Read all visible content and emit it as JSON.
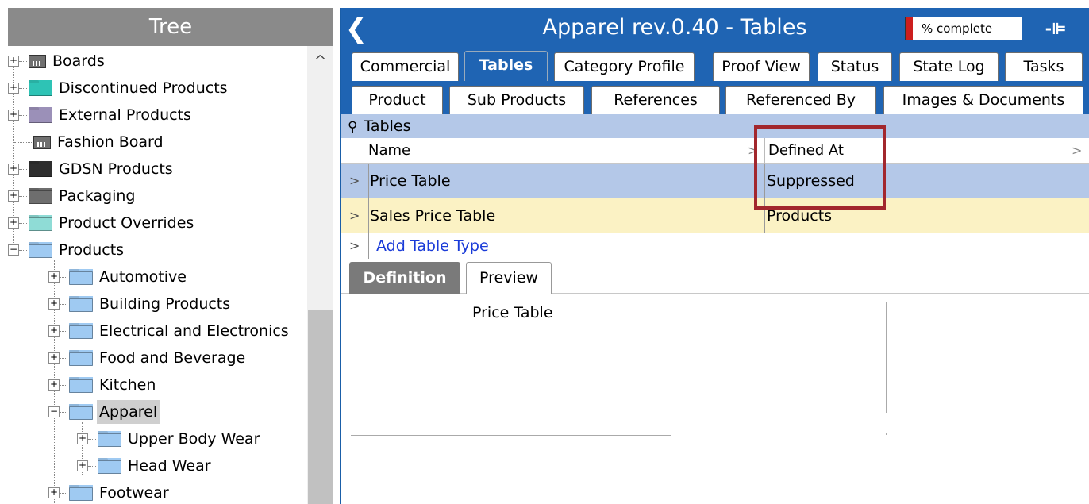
{
  "tree": {
    "title": "Tree",
    "nodes": [
      {
        "label": "Boards",
        "icon": "board-icon"
      },
      {
        "label": "Discontinued Products",
        "icon": "folder-icon",
        "color": "#2ec3b5"
      },
      {
        "label": "External Products",
        "icon": "folder-icon",
        "color": "#9b90b8"
      },
      {
        "label": "Fashion Board",
        "icon": "board-icon"
      },
      {
        "label": "GDSN Products",
        "icon": "folder-icon",
        "color": "#2e2e2e"
      },
      {
        "label": "Packaging",
        "icon": "folder-icon",
        "color": "#6e6e6e"
      },
      {
        "label": "Product Overrides",
        "icon": "folder-icon",
        "color": "#8fdcd6"
      },
      {
        "label": "Products",
        "icon": "folder-icon",
        "color": "#9fcaf2"
      },
      {
        "label": "Automotive",
        "icon": "folder-icon",
        "color": "#9fcaf2"
      },
      {
        "label": "Building Products",
        "icon": "folder-icon",
        "color": "#9fcaf2"
      },
      {
        "label": "Electrical and Electronics",
        "icon": "folder-icon",
        "color": "#9fcaf2"
      },
      {
        "label": "Food and Beverage",
        "icon": "folder-icon",
        "color": "#9fcaf2"
      },
      {
        "label": "Kitchen",
        "icon": "folder-icon",
        "color": "#9fcaf2"
      },
      {
        "label": "Apparel",
        "icon": "folder-icon",
        "color": "#9fcaf2"
      },
      {
        "label": "Upper Body Wear",
        "icon": "folder-icon",
        "color": "#9fcaf2"
      },
      {
        "label": "Head Wear",
        "icon": "folder-icon",
        "color": "#9fcaf2"
      },
      {
        "label": "Footwear",
        "icon": "folder-icon",
        "color": "#9fcaf2"
      }
    ],
    "expand_symbol": "+",
    "collapse_symbol": "−",
    "scroll_up": "^"
  },
  "editor": {
    "title": "Apparel rev.0.40 - Tables",
    "back_icon": "chevron-left-icon",
    "back_glyph": "❮",
    "progress": {
      "text": "% complete",
      "value_percent": 8
    },
    "pin_glyph": "-⊫",
    "tabs_row1": [
      "Commercial",
      "Tables",
      "Category Profile",
      "Proof View",
      "Status",
      "State Log",
      "Tasks"
    ],
    "tabs_row2": [
      "Product",
      "Sub Products",
      "References",
      "Referenced By",
      "Images & Documents"
    ],
    "active_tab": "Tables",
    "tables_section": {
      "header": "Tables",
      "col_name": "Name",
      "col_defined_at": "Defined At",
      "sort_glyph": ">",
      "rows": [
        {
          "name": "Price Table",
          "defined_at": "Suppressed"
        },
        {
          "name": "Sales Price Table",
          "defined_at": "Products"
        }
      ],
      "expand_glyph": ">",
      "add_link": "Add Table Type"
    },
    "sub_tabs": [
      "Definition",
      "Preview"
    ],
    "preview_title": "Price Table",
    "colors": {
      "accent": "#1f64b3",
      "selection": "#b4c8e8",
      "highlight_row": "#fbf2c4",
      "annotation": "#a2272d",
      "link": "#1a3bd8"
    }
  }
}
